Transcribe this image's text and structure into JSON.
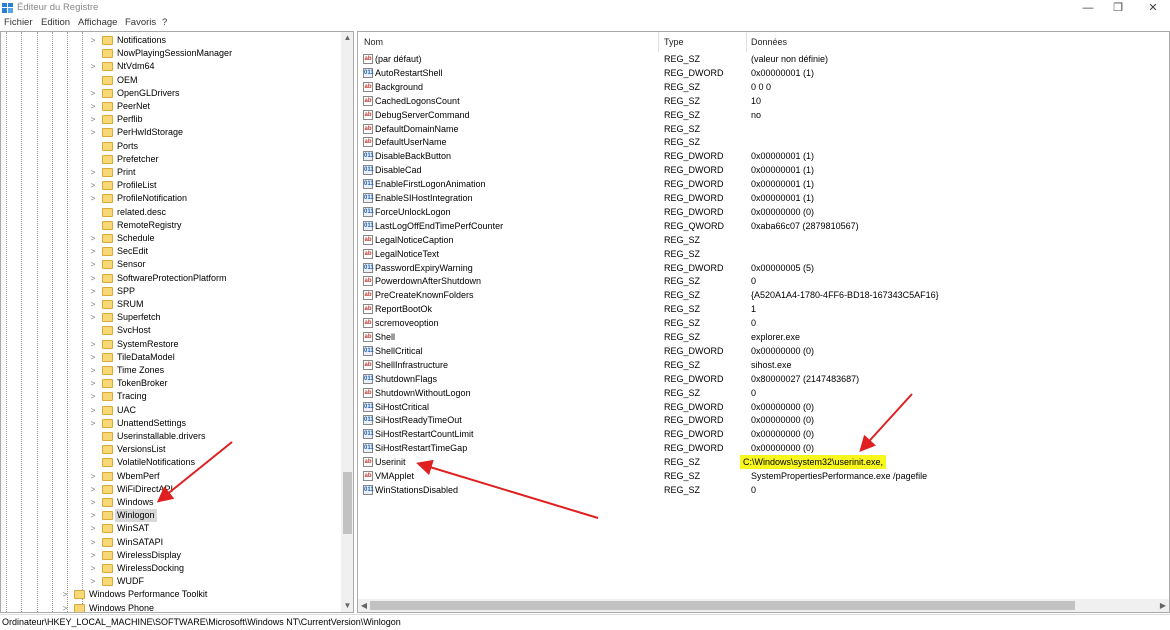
{
  "window": {
    "title": "Éditeur du Registre",
    "minimize": "—",
    "maximize": "❐",
    "close": "✕"
  },
  "menu": [
    "Fichier",
    "Edition",
    "Affichage",
    "Favoris",
    "?"
  ],
  "tree": {
    "items": [
      {
        "label": "Notifications",
        "expander": ">"
      },
      {
        "label": "NowPlayingSessionManager",
        "expander": ""
      },
      {
        "label": "NtVdm64",
        "expander": ">"
      },
      {
        "label": "OEM",
        "expander": ""
      },
      {
        "label": "OpenGLDrivers",
        "expander": ">"
      },
      {
        "label": "PeerNet",
        "expander": ">"
      },
      {
        "label": "Perflib",
        "expander": ">"
      },
      {
        "label": "PerHwIdStorage",
        "expander": ">"
      },
      {
        "label": "Ports",
        "expander": ""
      },
      {
        "label": "Prefetcher",
        "expander": ""
      },
      {
        "label": "Print",
        "expander": ">"
      },
      {
        "label": "ProfileList",
        "expander": ">"
      },
      {
        "label": "ProfileNotification",
        "expander": ">"
      },
      {
        "label": "related.desc",
        "expander": ""
      },
      {
        "label": "RemoteRegistry",
        "expander": ""
      },
      {
        "label": "Schedule",
        "expander": ">"
      },
      {
        "label": "SecEdit",
        "expander": ">"
      },
      {
        "label": "Sensor",
        "expander": ">"
      },
      {
        "label": "SoftwareProtectionPlatform",
        "expander": ">"
      },
      {
        "label": "SPP",
        "expander": ">"
      },
      {
        "label": "SRUM",
        "expander": ">"
      },
      {
        "label": "Superfetch",
        "expander": ">"
      },
      {
        "label": "SvcHost",
        "expander": ""
      },
      {
        "label": "SystemRestore",
        "expander": ">"
      },
      {
        "label": "TileDataModel",
        "expander": ">"
      },
      {
        "label": "Time Zones",
        "expander": ">"
      },
      {
        "label": "TokenBroker",
        "expander": ">"
      },
      {
        "label": "Tracing",
        "expander": ">"
      },
      {
        "label": "UAC",
        "expander": ">"
      },
      {
        "label": "UnattendSettings",
        "expander": ">"
      },
      {
        "label": "Userinstallable.drivers",
        "expander": ""
      },
      {
        "label": "VersionsList",
        "expander": ""
      },
      {
        "label": "VolatileNotifications",
        "expander": ""
      },
      {
        "label": "WbemPerf",
        "expander": ">"
      },
      {
        "label": "WiFiDirectAPI",
        "expander": ">"
      },
      {
        "label": "Windows",
        "expander": ">"
      },
      {
        "label": "Winlogon",
        "expander": ">",
        "selected": true
      },
      {
        "label": "WinSAT",
        "expander": ">"
      },
      {
        "label": "WinSATAPI",
        "expander": ">"
      },
      {
        "label": "WirelessDisplay",
        "expander": ">"
      },
      {
        "label": "WirelessDocking",
        "expander": ">"
      },
      {
        "label": "WUDF",
        "expander": ">"
      }
    ],
    "parent_items": [
      {
        "label": "Windows Performance Toolkit",
        "expander": ">"
      },
      {
        "label": "Windows Phone",
        "expander": ">"
      }
    ]
  },
  "values": {
    "headers": {
      "name": "Nom",
      "type": "Type",
      "data": "Données"
    },
    "rows": [
      {
        "icon": "ab",
        "name": "(par défaut)",
        "type": "REG_SZ",
        "data": "(valeur non définie)"
      },
      {
        "icon": "bin",
        "name": "AutoRestartShell",
        "type": "REG_DWORD",
        "data": "0x00000001 (1)"
      },
      {
        "icon": "ab",
        "name": "Background",
        "type": "REG_SZ",
        "data": "0 0 0"
      },
      {
        "icon": "ab",
        "name": "CachedLogonsCount",
        "type": "REG_SZ",
        "data": "10"
      },
      {
        "icon": "ab",
        "name": "DebugServerCommand",
        "type": "REG_SZ",
        "data": "no"
      },
      {
        "icon": "ab",
        "name": "DefaultDomainName",
        "type": "REG_SZ",
        "data": ""
      },
      {
        "icon": "ab",
        "name": "DefaultUserName",
        "type": "REG_SZ",
        "data": ""
      },
      {
        "icon": "bin",
        "name": "DisableBackButton",
        "type": "REG_DWORD",
        "data": "0x00000001 (1)"
      },
      {
        "icon": "bin",
        "name": "DisableCad",
        "type": "REG_DWORD",
        "data": "0x00000001 (1)"
      },
      {
        "icon": "bin",
        "name": "EnableFirstLogonAnimation",
        "type": "REG_DWORD",
        "data": "0x00000001 (1)"
      },
      {
        "icon": "bin",
        "name": "EnableSIHostIntegration",
        "type": "REG_DWORD",
        "data": "0x00000001 (1)"
      },
      {
        "icon": "bin",
        "name": "ForceUnlockLogon",
        "type": "REG_DWORD",
        "data": "0x00000000 (0)"
      },
      {
        "icon": "bin",
        "name": "LastLogOffEndTimePerfCounter",
        "type": "REG_QWORD",
        "data": "0xaba66c07 (2879810567)"
      },
      {
        "icon": "ab",
        "name": "LegalNoticeCaption",
        "type": "REG_SZ",
        "data": ""
      },
      {
        "icon": "ab",
        "name": "LegalNoticeText",
        "type": "REG_SZ",
        "data": ""
      },
      {
        "icon": "bin",
        "name": "PasswordExpiryWarning",
        "type": "REG_DWORD",
        "data": "0x00000005 (5)"
      },
      {
        "icon": "ab",
        "name": "PowerdownAfterShutdown",
        "type": "REG_SZ",
        "data": "0"
      },
      {
        "icon": "ab",
        "name": "PreCreateKnownFolders",
        "type": "REG_SZ",
        "data": "{A520A1A4-1780-4FF6-BD18-167343C5AF16}"
      },
      {
        "icon": "ab",
        "name": "ReportBootOk",
        "type": "REG_SZ",
        "data": "1"
      },
      {
        "icon": "ab",
        "name": "scremoveoption",
        "type": "REG_SZ",
        "data": "0"
      },
      {
        "icon": "ab",
        "name": "Shell",
        "type": "REG_SZ",
        "data": "explorer.exe"
      },
      {
        "icon": "bin",
        "name": "ShellCritical",
        "type": "REG_DWORD",
        "data": "0x00000000 (0)"
      },
      {
        "icon": "ab",
        "name": "ShellInfrastructure",
        "type": "REG_SZ",
        "data": "sihost.exe"
      },
      {
        "icon": "bin",
        "name": "ShutdownFlags",
        "type": "REG_DWORD",
        "data": "0x80000027 (2147483687)"
      },
      {
        "icon": "ab",
        "name": "ShutdownWithoutLogon",
        "type": "REG_SZ",
        "data": "0"
      },
      {
        "icon": "bin",
        "name": "SiHostCritical",
        "type": "REG_DWORD",
        "data": "0x00000000 (0)"
      },
      {
        "icon": "bin",
        "name": "SiHostReadyTimeOut",
        "type": "REG_DWORD",
        "data": "0x00000000 (0)"
      },
      {
        "icon": "bin",
        "name": "SiHostRestartCountLimit",
        "type": "REG_DWORD",
        "data": "0x00000000 (0)"
      },
      {
        "icon": "bin",
        "name": "SiHostRestartTimeGap",
        "type": "REG_DWORD",
        "data": "0x00000000 (0)"
      },
      {
        "icon": "ab",
        "name": "Userinit",
        "type": "REG_SZ",
        "data": "C:\\Windows\\system32\\userinit.exe,",
        "highlight": true
      },
      {
        "icon": "ab",
        "name": "VMApplet",
        "type": "REG_SZ",
        "data": "SystemPropertiesPerformance.exe /pagefile"
      },
      {
        "icon": "bin",
        "name": "WinStationsDisabled",
        "type": "REG_SZ",
        "data": "0"
      }
    ]
  },
  "statusbar": {
    "path": "Ordinateur\\HKEY_LOCAL_MACHINE\\SOFTWARE\\Microsoft\\Windows NT\\CurrentVersion\\Winlogon"
  },
  "icons": {
    "string_value": "ab",
    "binary_value": "011"
  },
  "colors": {
    "highlight": "#f7f71e",
    "annotation_arrow": "#e02020",
    "folder": "#f8d775",
    "selection": "#d9d9d9"
  }
}
